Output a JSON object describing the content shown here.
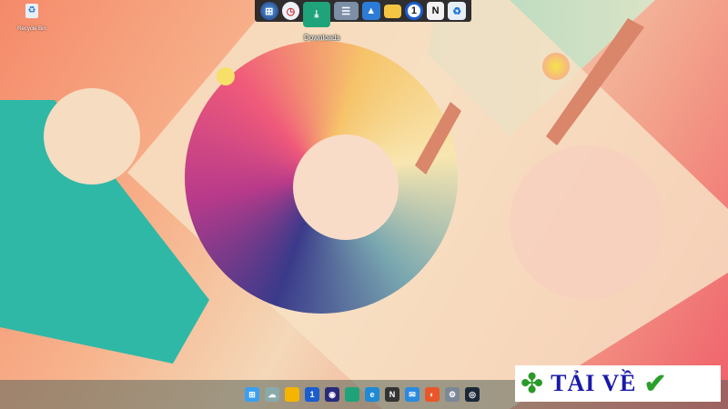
{
  "desktop": {
    "icons": [
      {
        "label": "Recycle Bin",
        "icon": "recycle-bin-icon"
      }
    ]
  },
  "dock": {
    "items": [
      {
        "name": "start-orb",
        "icon": "windows-orb-icon",
        "color": "#2a62b8"
      },
      {
        "name": "clock",
        "icon": "clock-icon",
        "color": "#eef2f8"
      },
      {
        "name": "downloads",
        "icon": "downloads-folder-icon",
        "color": "#1fa37a"
      },
      {
        "name": "documents",
        "icon": "documents-folder-icon",
        "color": "#7c8fa6"
      },
      {
        "name": "pictures",
        "icon": "pictures-folder-icon",
        "color": "#2c7bd6"
      },
      {
        "name": "folder",
        "icon": "folder-icon",
        "color": "#f4c542"
      },
      {
        "name": "1password",
        "icon": "1password-icon",
        "color": "#1a5dcf"
      },
      {
        "name": "notion",
        "icon": "notion-icon",
        "color": "#f2f2f2"
      },
      {
        "name": "recycle-bin",
        "icon": "recycle-bin-icon",
        "color": "#e8eef6"
      }
    ],
    "hover_label": "Downloads"
  },
  "taskbar": {
    "items": [
      {
        "name": "start",
        "icon": "windows-icon",
        "color": "#3aa0f0",
        "glyph": "⊞"
      },
      {
        "name": "weather",
        "icon": "weather-icon",
        "color": "#8aa",
        "glyph": "☁"
      },
      {
        "name": "file-explorer",
        "icon": "folder-icon",
        "color": "#f4b400",
        "glyph": ""
      },
      {
        "name": "1password",
        "icon": "1password-icon",
        "color": "#1a5dcf",
        "glyph": "1"
      },
      {
        "name": "app",
        "icon": "app-icon",
        "color": "#2a2a7a",
        "glyph": "◉"
      },
      {
        "name": "downloads",
        "icon": "folder-icon",
        "color": "#1fa37a",
        "glyph": ""
      },
      {
        "name": "edge",
        "icon": "edge-icon",
        "color": "#1f8ad6",
        "glyph": "e"
      },
      {
        "name": "notion",
        "icon": "notion-icon",
        "color": "#333",
        "glyph": "N"
      },
      {
        "name": "mail",
        "icon": "mail-icon",
        "color": "#2a8ae0",
        "glyph": "✉"
      },
      {
        "name": "firefox",
        "icon": "firefox-icon",
        "color": "#e8562a",
        "glyph": "◐"
      },
      {
        "name": "settings",
        "icon": "gear-icon",
        "color": "#7a8898",
        "glyph": "⚙"
      },
      {
        "name": "steam",
        "icon": "steam-icon",
        "color": "#1b2838",
        "glyph": "◎"
      }
    ]
  },
  "watermark": {
    "text": "TẢI VỀ"
  }
}
